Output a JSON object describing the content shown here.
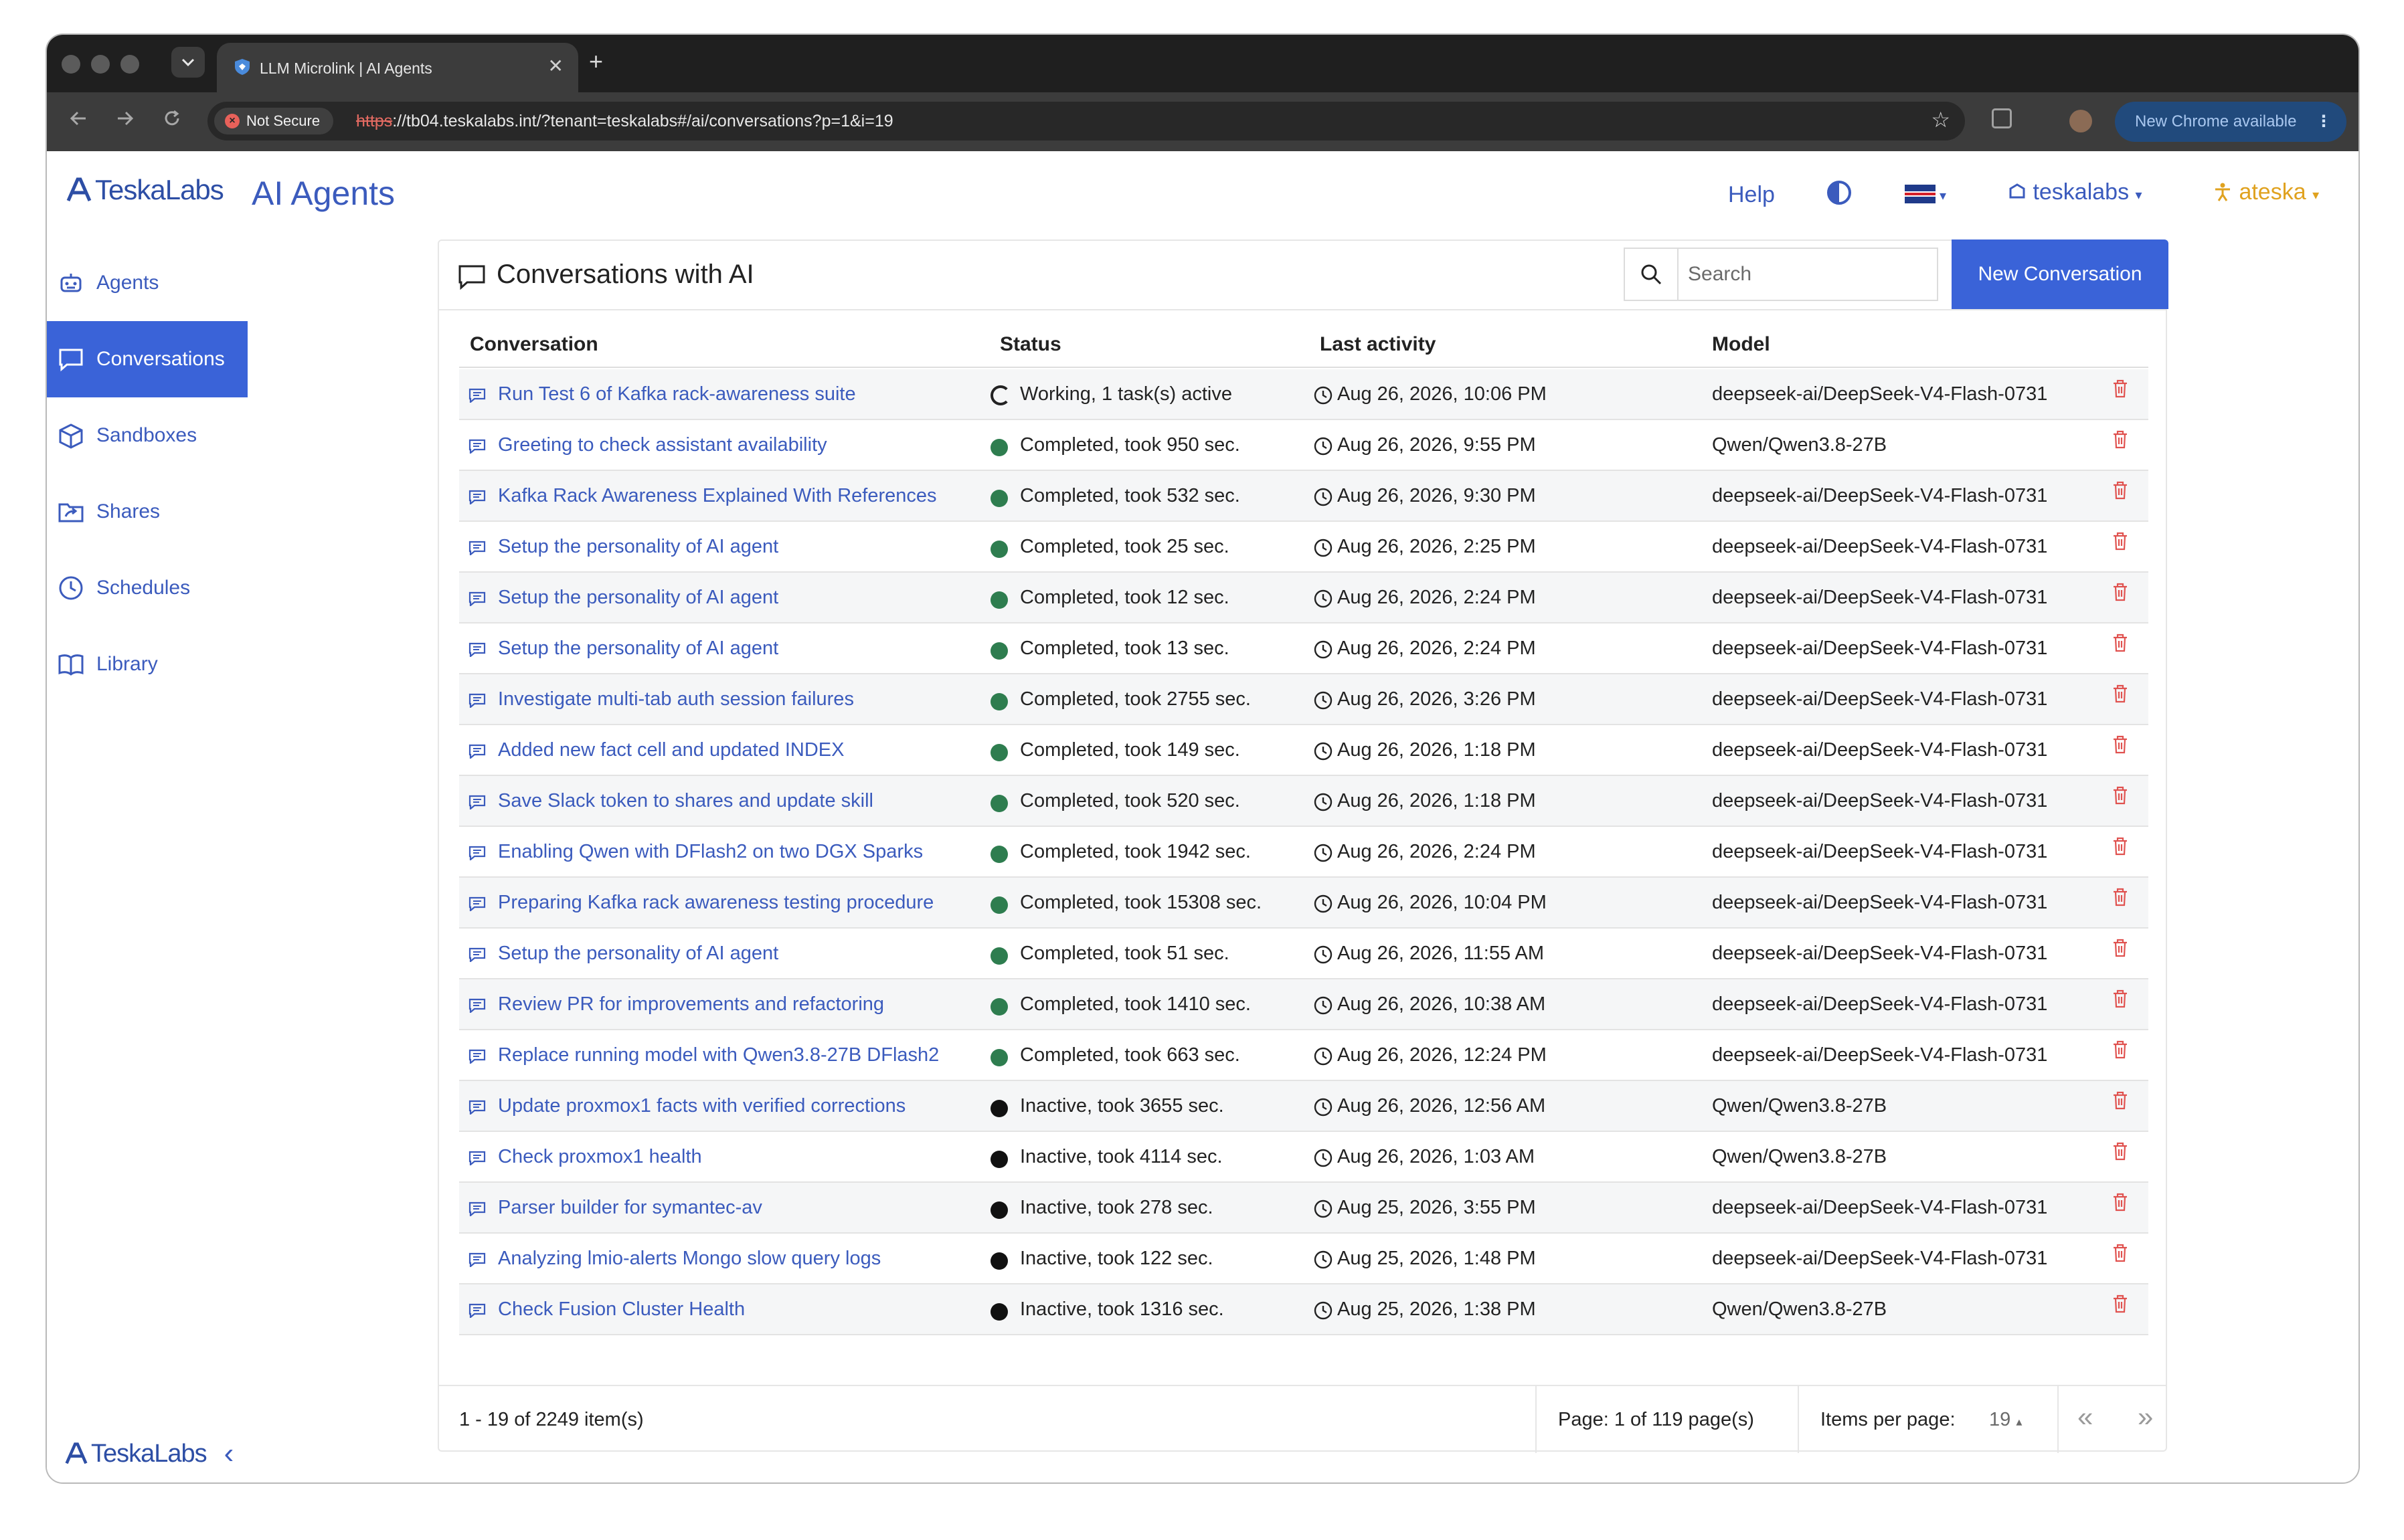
{
  "browser": {
    "tab_title": "LLM Microlink | AI Agents",
    "tab_close": "✕",
    "tab_new": "+",
    "security_label": "Not Secure",
    "url_scheme": "https",
    "url_rest": "://tb04.teskalabs.int/?tenant=teskalabs#/ai/conversations?p=1&i=19",
    "update_label": "New Chrome available",
    "icons": [
      "back-icon",
      "forward-icon",
      "reload-icon",
      "star-icon",
      "extensions-icon",
      "menu-icon"
    ]
  },
  "header": {
    "logo_text": "TeskaLabs",
    "app_name": "AI Agents",
    "help_label": "Help",
    "tenant_label": "teskalabs",
    "user_label": "ateska",
    "accent_color": "#3b5bbd",
    "user_color": "#e0a21f"
  },
  "sidebar": {
    "items": [
      {
        "label": "Agents",
        "icon": "robot-icon"
      },
      {
        "label": "Conversations",
        "icon": "chat-icon"
      },
      {
        "label": "Sandboxes",
        "icon": "box-icon"
      },
      {
        "label": "Shares",
        "icon": "folder-share-icon"
      },
      {
        "label": "Schedules",
        "icon": "clock-icon"
      },
      {
        "label": "Library",
        "icon": "book-icon"
      }
    ],
    "active": "Conversations",
    "active_color": "#3a63d8",
    "bottom_logo_text": "TeskaLabs"
  },
  "main": {
    "title": "Conversations with AI",
    "search_placeholder": "Search",
    "new_button_label": "New Conversation",
    "columns": [
      "Conversation",
      "Status",
      "Last activity",
      "Model"
    ],
    "status_colors": {
      "working": "#222222",
      "completed": "#2e7d4f",
      "inactive": "#111111"
    },
    "rows": [
      {
        "title": "Run Test 6 of Kafka rack-awareness suite",
        "state": "working",
        "status": "Working, 1 task(s) active",
        "time": "Aug 26, 2026, 10:06 PM",
        "model": "deepseek-ai/DeepSeek-V4-Flash-0731"
      },
      {
        "title": "Greeting to check assistant availability",
        "state": "completed",
        "status": "Completed, took 950 sec.",
        "time": "Aug 26, 2026, 9:55 PM",
        "model": "Qwen/Qwen3.8-27B"
      },
      {
        "title": "Kafka Rack Awareness Explained With References",
        "state": "completed",
        "status": "Completed, took 532 sec.",
        "time": "Aug 26, 2026, 9:30 PM",
        "model": "deepseek-ai/DeepSeek-V4-Flash-0731"
      },
      {
        "title": "Setup the personality of AI agent",
        "state": "completed",
        "status": "Completed, took 25 sec.",
        "time": "Aug 26, 2026, 2:25 PM",
        "model": "deepseek-ai/DeepSeek-V4-Flash-0731"
      },
      {
        "title": "Setup the personality of AI agent",
        "state": "completed",
        "status": "Completed, took 12 sec.",
        "time": "Aug 26, 2026, 2:24 PM",
        "model": "deepseek-ai/DeepSeek-V4-Flash-0731"
      },
      {
        "title": "Setup the personality of AI agent",
        "state": "completed",
        "status": "Completed, took 13 sec.",
        "time": "Aug 26, 2026, 2:24 PM",
        "model": "deepseek-ai/DeepSeek-V4-Flash-0731"
      },
      {
        "title": "Investigate multi-tab auth session failures",
        "state": "completed",
        "status": "Completed, took 2755 sec.",
        "time": "Aug 26, 2026, 3:26 PM",
        "model": "deepseek-ai/DeepSeek-V4-Flash-0731"
      },
      {
        "title": "Added new fact cell and updated INDEX",
        "state": "completed",
        "status": "Completed, took 149 sec.",
        "time": "Aug 26, 2026, 1:18 PM",
        "model": "deepseek-ai/DeepSeek-V4-Flash-0731"
      },
      {
        "title": "Save Slack token to shares and update skill",
        "state": "completed",
        "status": "Completed, took 520 sec.",
        "time": "Aug 26, 2026, 1:18 PM",
        "model": "deepseek-ai/DeepSeek-V4-Flash-0731"
      },
      {
        "title": "Enabling Qwen with DFlash2 on two DGX Sparks",
        "state": "completed",
        "status": "Completed, took 1942 sec.",
        "time": "Aug 26, 2026, 2:24 PM",
        "model": "deepseek-ai/DeepSeek-V4-Flash-0731"
      },
      {
        "title": "Preparing Kafka rack awareness testing procedure",
        "state": "completed",
        "status": "Completed, took 15308 sec.",
        "time": "Aug 26, 2026, 10:04 PM",
        "model": "deepseek-ai/DeepSeek-V4-Flash-0731"
      },
      {
        "title": "Setup the personality of AI agent",
        "state": "completed",
        "status": "Completed, took 51 sec.",
        "time": "Aug 26, 2026, 11:55 AM",
        "model": "deepseek-ai/DeepSeek-V4-Flash-0731"
      },
      {
        "title": "Review PR for improvements and refactoring",
        "state": "completed",
        "status": "Completed, took 1410 sec.",
        "time": "Aug 26, 2026, 10:38 AM",
        "model": "deepseek-ai/DeepSeek-V4-Flash-0731"
      },
      {
        "title": "Replace running model with Qwen3.8-27B DFlash2",
        "state": "completed",
        "status": "Completed, took 663 sec.",
        "time": "Aug 26, 2026, 12:24 PM",
        "model": "deepseek-ai/DeepSeek-V4-Flash-0731"
      },
      {
        "title": "Update proxmox1 facts with verified corrections",
        "state": "inactive",
        "status": "Inactive, took 3655 sec.",
        "time": "Aug 26, 2026, 12:56 AM",
        "model": "Qwen/Qwen3.8-27B"
      },
      {
        "title": "Check proxmox1 health",
        "state": "inactive",
        "status": "Inactive, took 4114 sec.",
        "time": "Aug 26, 2026, 1:03 AM",
        "model": "Qwen/Qwen3.8-27B"
      },
      {
        "title": "Parser builder for symantec-av",
        "state": "inactive",
        "status": "Inactive, took 278 sec.",
        "time": "Aug 25, 2026, 3:55 PM",
        "model": "deepseek-ai/DeepSeek-V4-Flash-0731"
      },
      {
        "title": "Analyzing lmio-alerts Mongo slow query logs",
        "state": "inactive",
        "status": "Inactive, took 122 sec.",
        "time": "Aug 25, 2026, 1:48 PM",
        "model": "deepseek-ai/DeepSeek-V4-Flash-0731"
      },
      {
        "title": "Check Fusion Cluster Health",
        "state": "inactive",
        "status": "Inactive, took 1316 sec.",
        "time": "Aug 25, 2026, 1:38 PM",
        "model": "Qwen/Qwen3.8-27B"
      }
    ]
  },
  "footer": {
    "count_label": "1 - 19 of 2249 item(s)",
    "page_label": "Page: 1 of 119 page(s)",
    "items_per_page_label": "Items per page:",
    "items_per_page_value": "19",
    "items_per_page_caret": "▴",
    "prev_glyph": "«",
    "next_glyph": "»"
  }
}
